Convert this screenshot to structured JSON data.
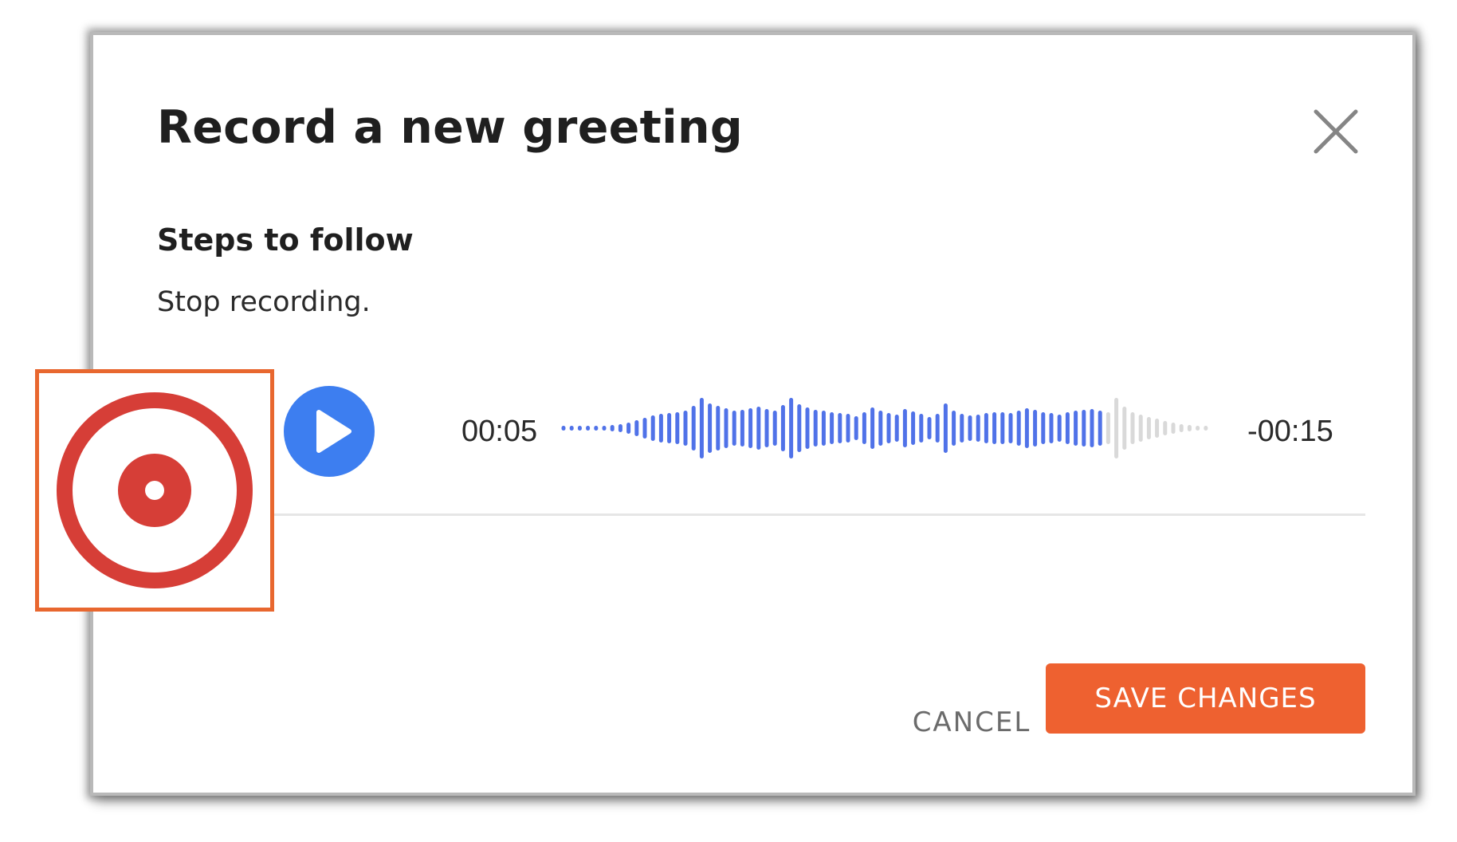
{
  "dialog": {
    "title": "Record a new greeting",
    "close_icon": "close-icon",
    "steps_heading": "Steps to follow",
    "step_text": "Stop recording."
  },
  "player": {
    "play_icon": "play-icon",
    "elapsed": "00:05",
    "remaining": "-00:15",
    "played_color": "#5072e8",
    "unplayed_color": "#d9d9d9",
    "play_button_color": "#3d7ef0"
  },
  "actions": {
    "cancel_label": "CANCEL",
    "save_label": "SAVE CHANGES",
    "save_color": "#ee6130"
  },
  "callout": {
    "icon": "record-stop-icon",
    "icon_color": "#d63e37",
    "border_color": "#e8672f"
  }
}
